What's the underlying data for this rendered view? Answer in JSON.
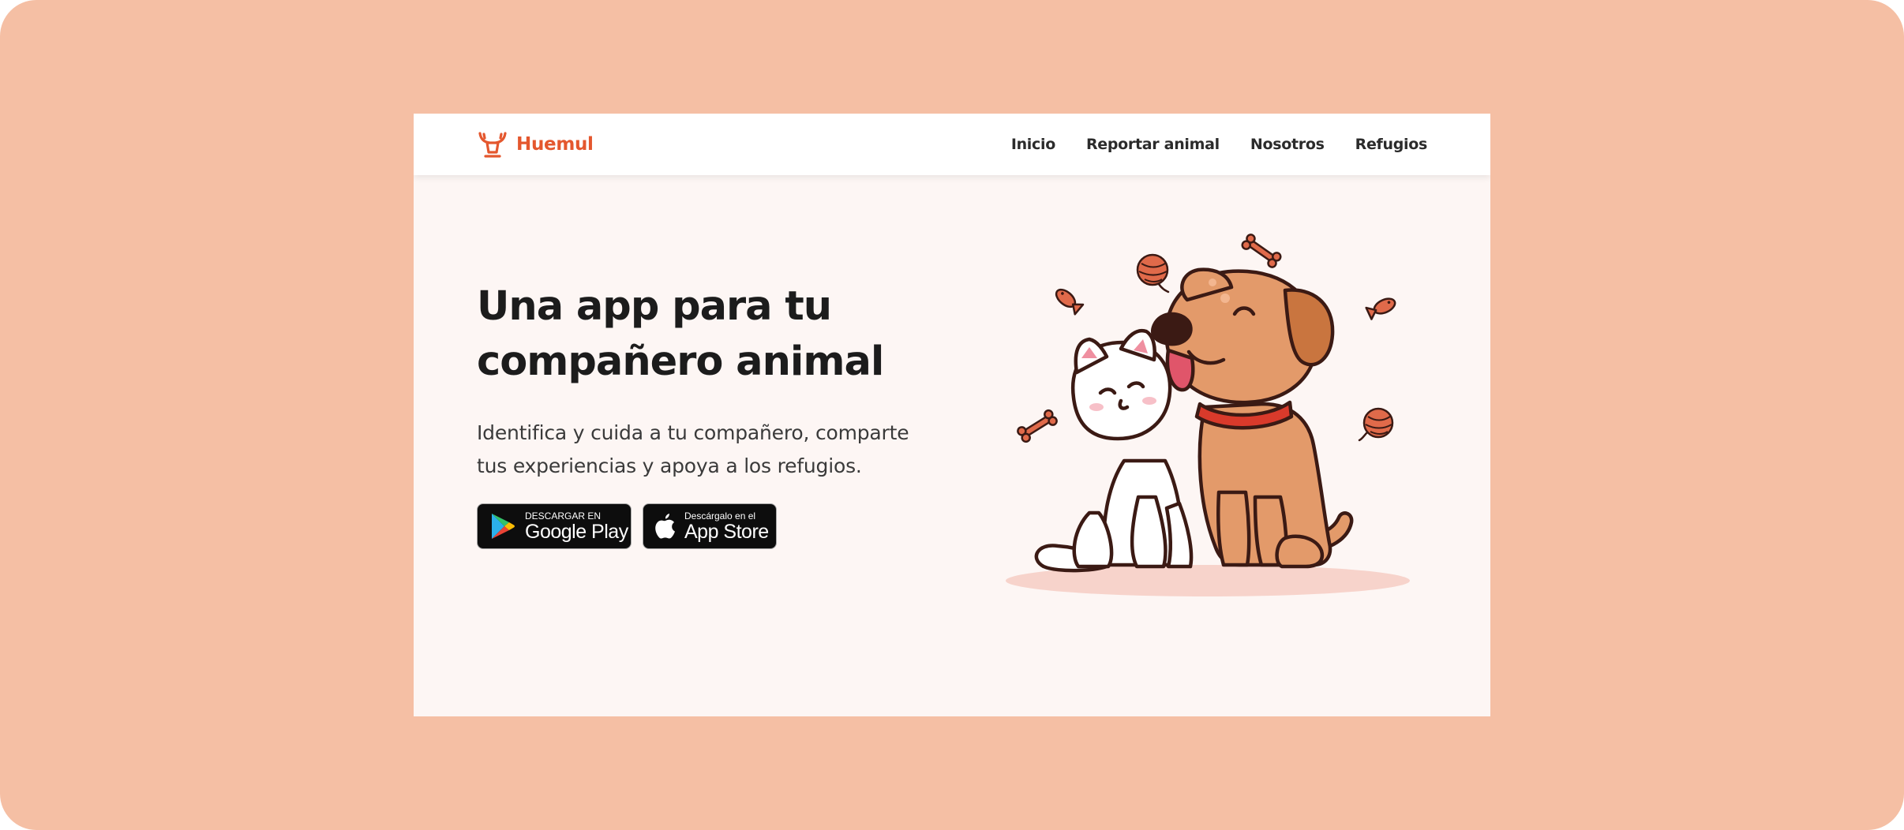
{
  "brand": {
    "name": "Huemul",
    "icon": "deer-antlers-icon",
    "color": "#e4572e"
  },
  "nav": {
    "items": [
      {
        "label": "Inicio"
      },
      {
        "label": "Reportar animal"
      },
      {
        "label": "Nosotros"
      },
      {
        "label": "Refugios"
      }
    ]
  },
  "hero": {
    "title_line1": "Una app para tu",
    "title_line2": "compañero animal",
    "subtitle_line1": "Identifica y cuida a tu compañero, comparte",
    "subtitle_line2": "tus experiencias y apoya a los refugios."
  },
  "stores": {
    "google_play": {
      "small": "DESCARGAR EN",
      "big": "Google Play",
      "icon": "google-play-icon"
    },
    "app_store": {
      "small": "Descárgalo en el",
      "big": "App Store",
      "icon": "apple-icon"
    }
  },
  "illustration": {
    "icon": "cat-and-dog-illustration"
  },
  "colors": {
    "backdrop": "#f5bfa4",
    "page_bg": "#fdf6f4",
    "navbar_bg": "#ffffff",
    "accent": "#e4572e",
    "dog": "#e39a6a",
    "collar": "#d93a2b"
  }
}
